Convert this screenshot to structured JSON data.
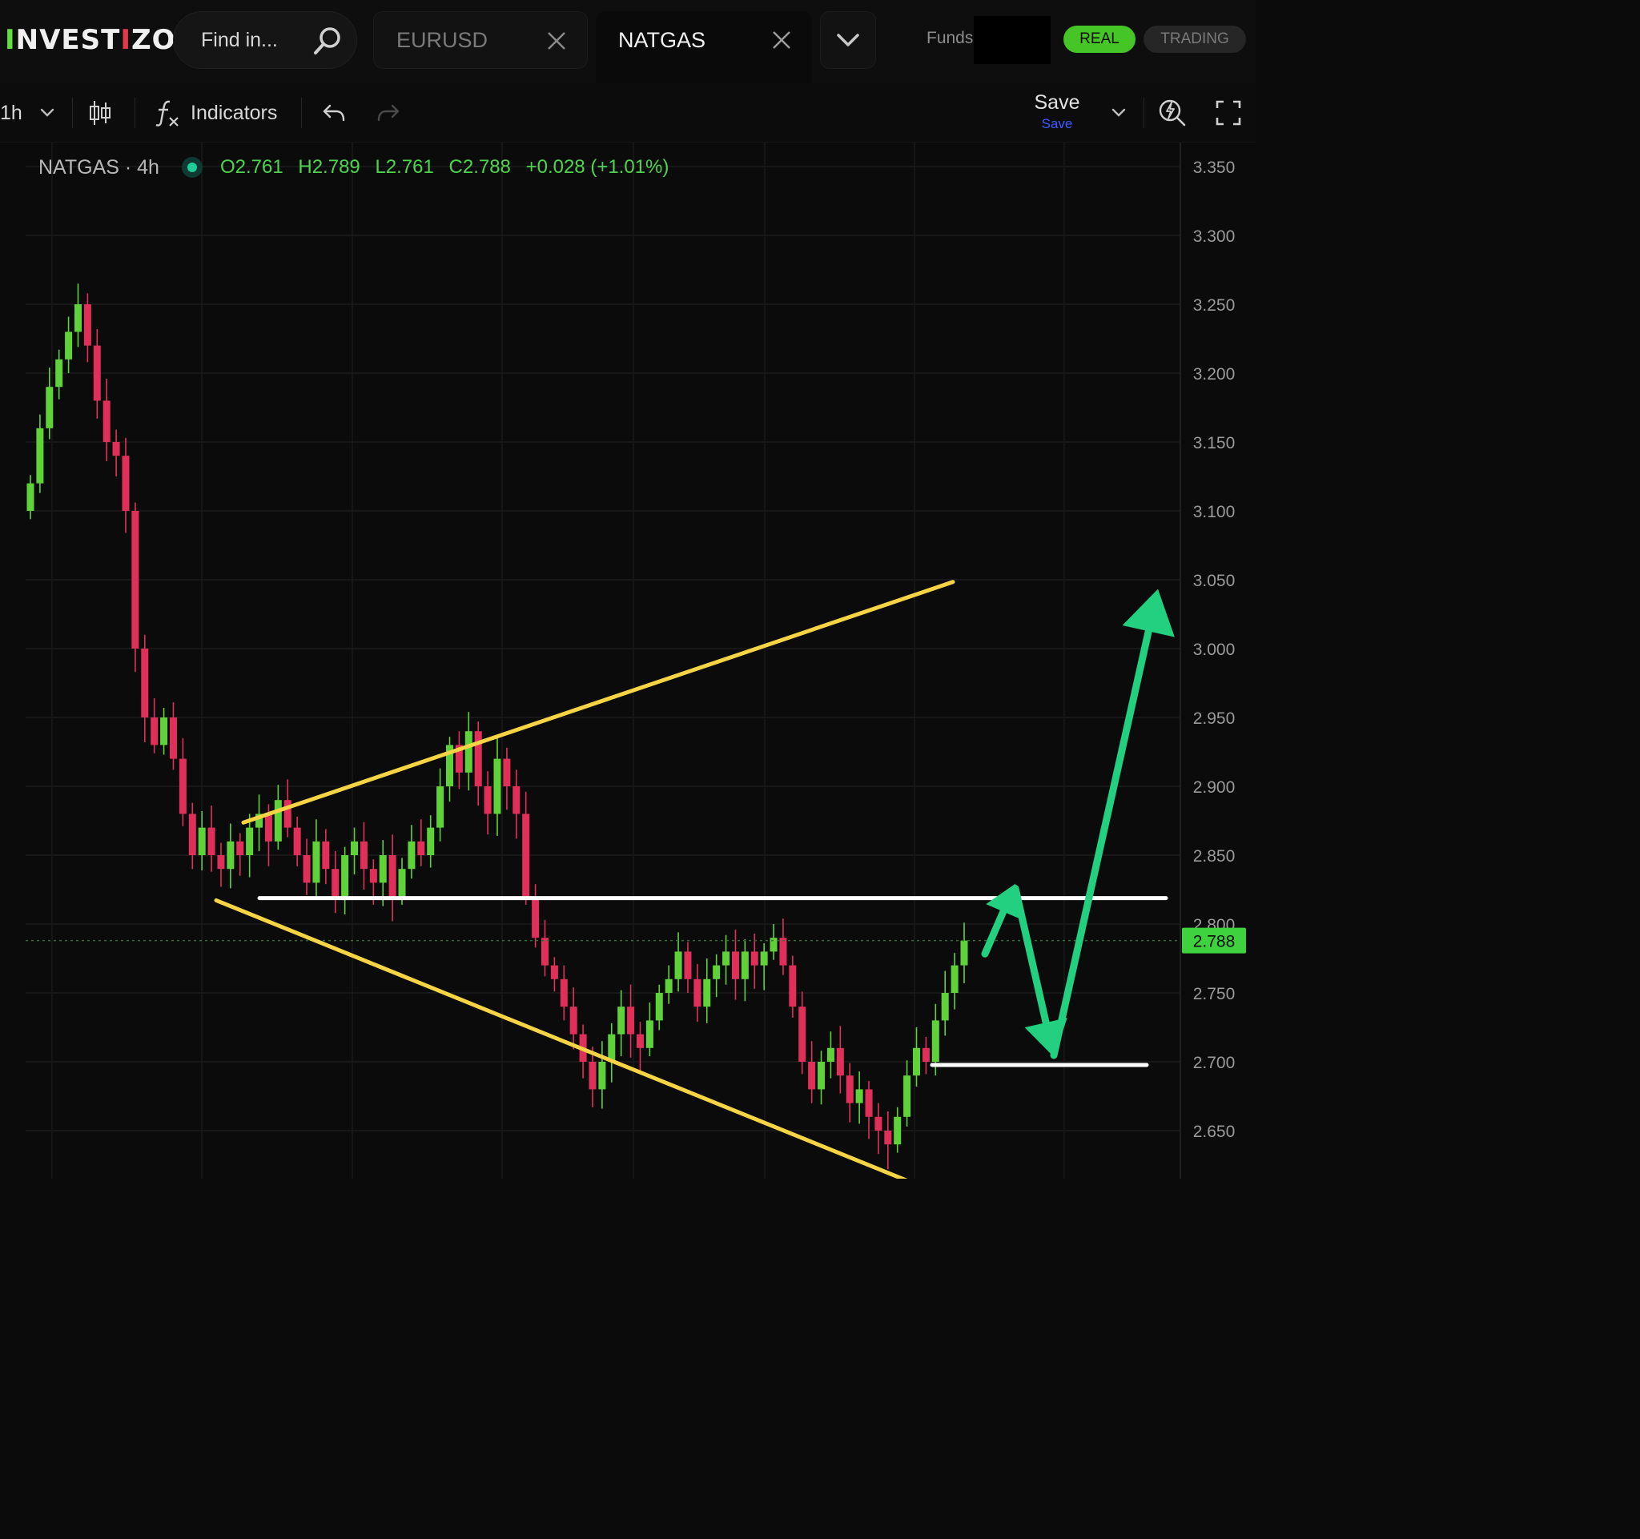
{
  "header": {
    "logo": {
      "part1": "I",
      "part2": "NVEST",
      "part3": "I",
      "part4": "ZO"
    },
    "search": {
      "placeholder": "Find in..."
    },
    "tabs": [
      {
        "label": "EURUSD",
        "active": false
      },
      {
        "label": "NATGAS",
        "active": true
      }
    ],
    "funds_label": "Funds",
    "mode_real": "REAL",
    "mode_trading": "TRADING"
  },
  "toolbar": {
    "interval": "1h",
    "indicators_label": "Indicators",
    "save_label": "Save",
    "save_sub": "Save"
  },
  "legend": {
    "symbol": "NATGAS · 4h",
    "open": "O2.761",
    "high": "H2.789",
    "low": "L2.761",
    "close": "C2.788",
    "change": "+0.028 (+1.01%)"
  },
  "colors": {
    "up": "#5fd23a",
    "down": "#e0305a",
    "trendline": "#f7d443",
    "level": "#ffffff",
    "arrow": "#22d07f",
    "price_tag": "#3fd23f"
  },
  "chart_data": {
    "type": "candlestick",
    "symbol": "NATGAS",
    "interval": "4h",
    "y_ticks": [
      "3.350",
      "3.300",
      "3.250",
      "3.200",
      "3.150",
      "3.100",
      "3.050",
      "3.000",
      "2.950",
      "2.900",
      "2.850",
      "2.800",
      "2.750",
      "2.700",
      "2.650"
    ],
    "ylim": [
      2.63,
      3.36
    ],
    "last_price": 2.788,
    "last_price_label": "2.788",
    "series_close": [
      3.12,
      3.16,
      3.19,
      3.21,
      3.23,
      3.25,
      3.22,
      3.18,
      3.15,
      3.14,
      3.1,
      3.0,
      2.95,
      2.93,
      2.95,
      2.92,
      2.88,
      2.85,
      2.87,
      2.85,
      2.84,
      2.86,
      2.85,
      2.87,
      2.88,
      2.86,
      2.89,
      2.87,
      2.85,
      2.83,
      2.86,
      2.84,
      2.82,
      2.85,
      2.86,
      2.84,
      2.83,
      2.85,
      2.82,
      2.84,
      2.86,
      2.85,
      2.87,
      2.9,
      2.93,
      2.91,
      2.94,
      2.9,
      2.88,
      2.92,
      2.9,
      2.88,
      2.82,
      2.79,
      2.77,
      2.76,
      2.74,
      2.72,
      2.7,
      2.68,
      2.7,
      2.72,
      2.74,
      2.72,
      2.71,
      2.73,
      2.75,
      2.76,
      2.78,
      2.76,
      2.74,
      2.76,
      2.77,
      2.78,
      2.76,
      2.78,
      2.77,
      2.78,
      2.79,
      2.77,
      2.74,
      2.7,
      2.68,
      2.7,
      2.71,
      2.69,
      2.67,
      2.68,
      2.66,
      2.65,
      2.64,
      2.66,
      2.69,
      2.71,
      2.7,
      2.73,
      2.75,
      2.77,
      2.788
    ],
    "annotations": {
      "upper_trendline": {
        "from": 2.89,
        "to": 3.06
      },
      "lower_trendline": {
        "from": 2.83,
        "to": 2.62
      },
      "resistance": 2.82,
      "support": 2.7,
      "projection_path": [
        2.79,
        2.82,
        2.7,
        3.02
      ]
    }
  }
}
